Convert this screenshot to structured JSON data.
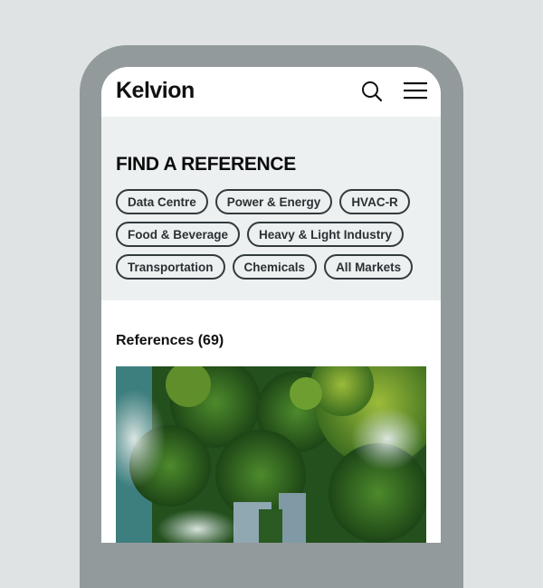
{
  "header": {
    "logo": "Kelvion",
    "search_icon": "search-icon",
    "menu_icon": "hamburger-menu-icon"
  },
  "filter": {
    "title": "FIND A REFERENCE",
    "chips": [
      {
        "label": "Data Centre"
      },
      {
        "label": "Power & Energy"
      },
      {
        "label": "HVAC-R"
      },
      {
        "label": "Food & Beverage"
      },
      {
        "label": "Heavy & Light Industry"
      },
      {
        "label": "Transportation"
      },
      {
        "label": "Chemicals"
      },
      {
        "label": "All Markets"
      }
    ]
  },
  "results": {
    "heading": "References (69)",
    "image_alt": "Aerial view of green forest with lakes"
  },
  "colors": {
    "background": "#dfe3e4",
    "frame": "#939a9c",
    "filter_bg": "#ecf0f1",
    "chip_border": "#333a3d"
  }
}
